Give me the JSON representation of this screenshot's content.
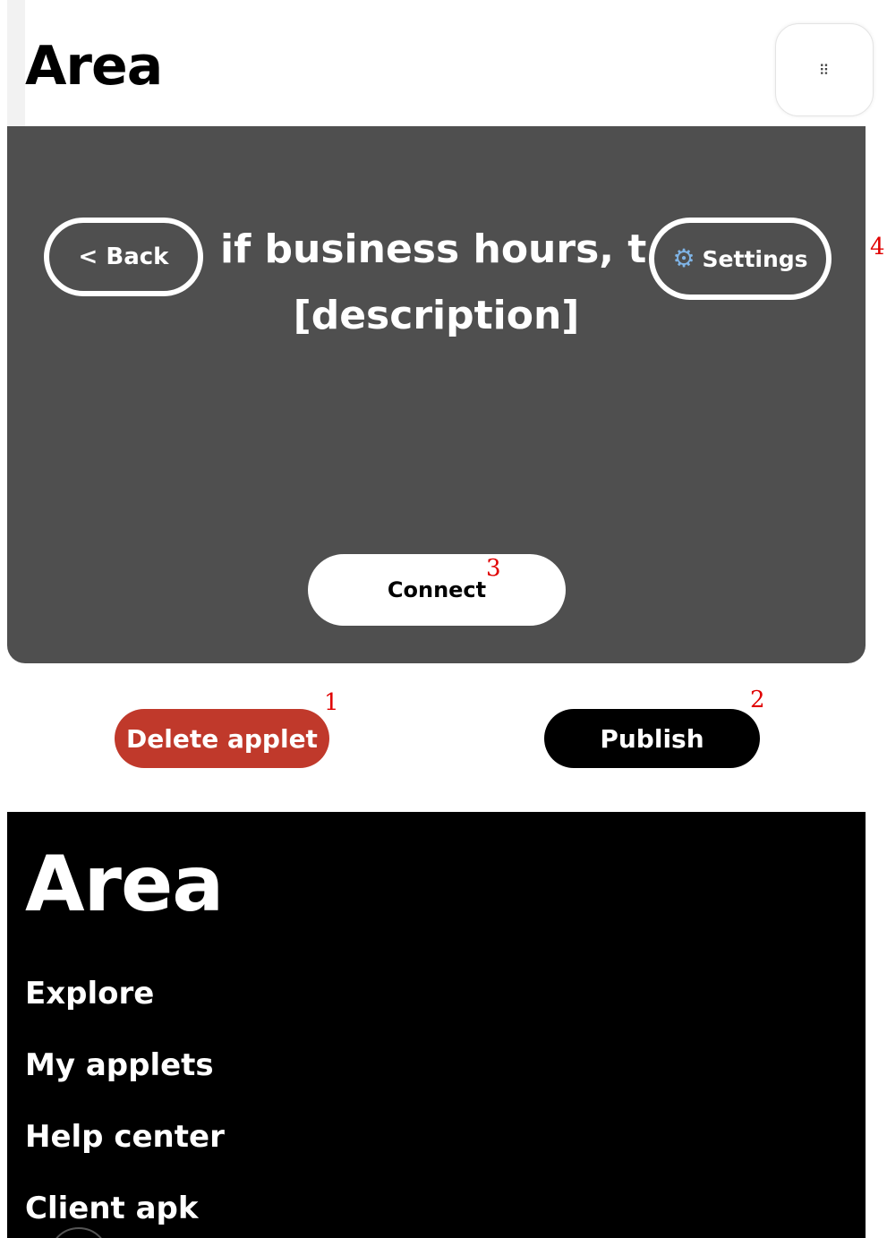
{
  "header": {
    "brand": "Area",
    "menu_icon": "⠿"
  },
  "applet": {
    "back_label": "< Back",
    "title": "if business hours, t...",
    "description": "[description]",
    "settings_label": "Settings",
    "settings_icon": "gear-icon",
    "connect_label": "Connect"
  },
  "actions": {
    "delete_label": "Delete applet",
    "publish_label": "Publish"
  },
  "markers": [
    "1",
    "2",
    "3",
    "4"
  ],
  "footer": {
    "brand": "Area",
    "links": [
      "Explore",
      "My applets",
      "Help center",
      "Client apk"
    ]
  },
  "colors": {
    "card_bg": "#4f4f4f",
    "delete_bg": "#c0392b",
    "publish_bg": "#000000",
    "gear": "#7fb4e6"
  }
}
